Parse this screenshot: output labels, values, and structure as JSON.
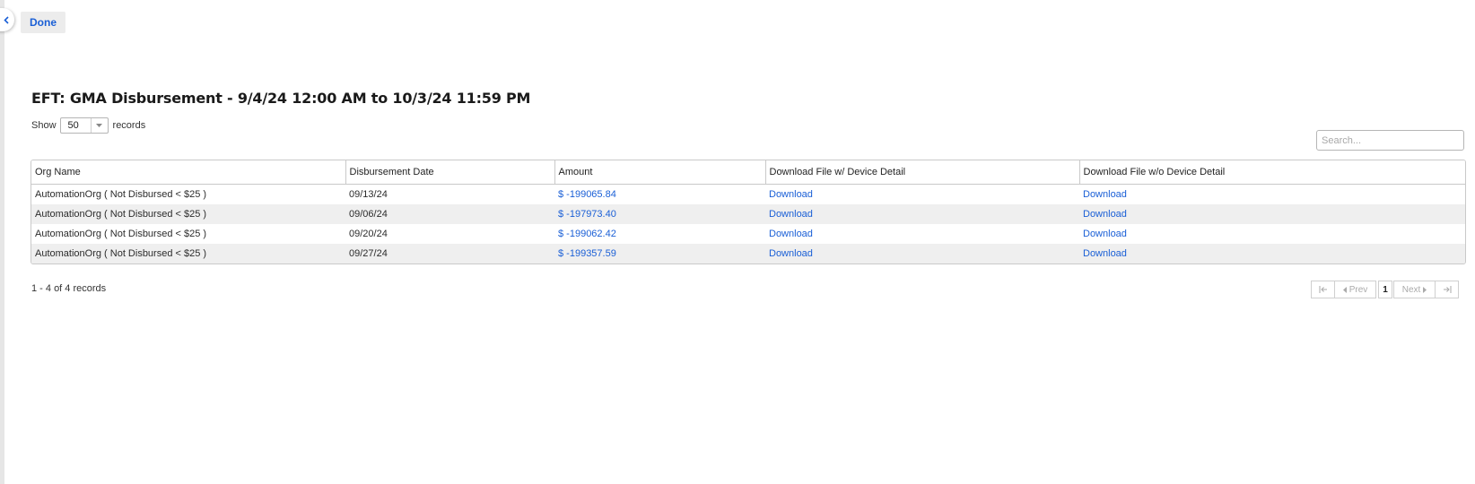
{
  "toolbar": {
    "done_label": "Done"
  },
  "page": {
    "title": "EFT: GMA Disbursement - 9/4/24 12:00 AM to 10/3/24 11:59 PM"
  },
  "length_control": {
    "show_label": "Show",
    "value": "50",
    "records_label": "records"
  },
  "search": {
    "placeholder": "Search..."
  },
  "table": {
    "headers": [
      "Org Name",
      "Disbursement Date",
      "Amount",
      "Download File w/ Device Detail",
      "Download File w/o Device Detail"
    ],
    "rows": [
      {
        "org": "AutomationOrg ( Not Disbursed < $25 )",
        "date": "09/13/24",
        "amount": "$ -199065.84",
        "dl_with": "Download",
        "dl_without": "Download"
      },
      {
        "org": "AutomationOrg ( Not Disbursed < $25 )",
        "date": "09/06/24",
        "amount": "$ -197973.40",
        "dl_with": "Download",
        "dl_without": "Download"
      },
      {
        "org": "AutomationOrg ( Not Disbursed < $25 )",
        "date": "09/20/24",
        "amount": "$ -199062.42",
        "dl_with": "Download",
        "dl_without": "Download"
      },
      {
        "org": "AutomationOrg ( Not Disbursed < $25 )",
        "date": "09/27/24",
        "amount": "$ -199357.59",
        "dl_with": "Download",
        "dl_without": "Download"
      }
    ]
  },
  "summary": {
    "text": "1 - 4 of 4 records"
  },
  "pager": {
    "prev_label": "Prev",
    "current_page": "1",
    "next_label": "Next"
  },
  "colors": {
    "link": "#1a5fd6",
    "row_alt": "#efefef",
    "border": "#c9c9c9"
  }
}
